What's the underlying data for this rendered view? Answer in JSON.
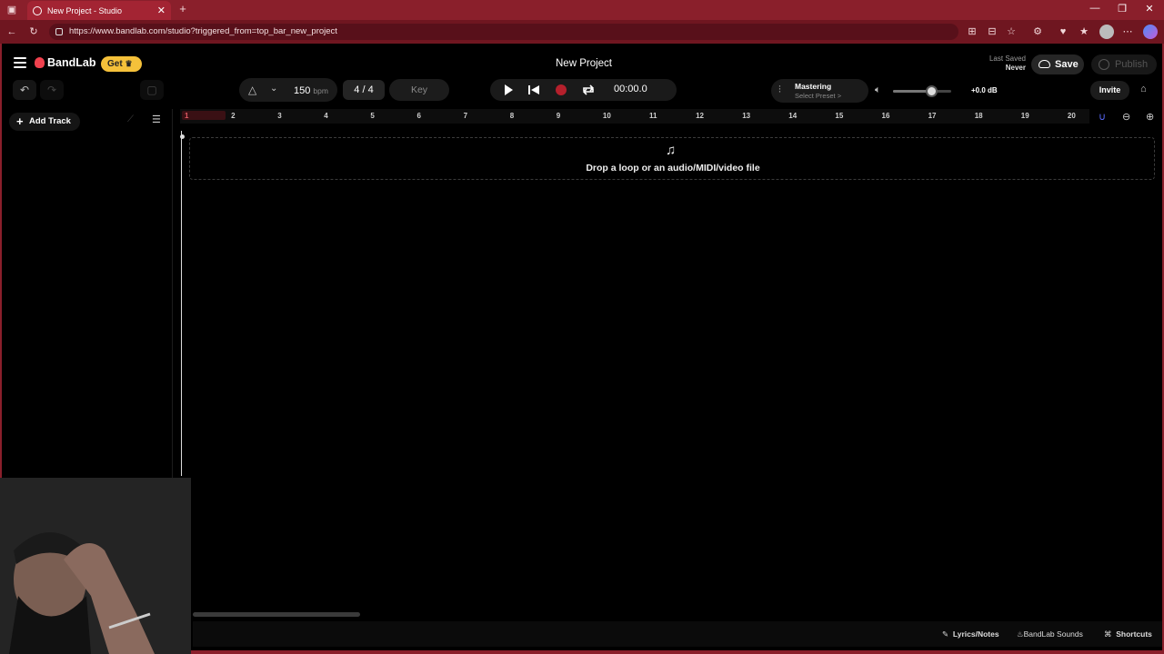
{
  "browser": {
    "tab_title": "New Project - Studio",
    "new_tab": "+",
    "url": "https://www.bandlab.com/studio?triggered_from=top_bar_new_project",
    "window_controls": [
      "—",
      "❐",
      "✕"
    ]
  },
  "header": {
    "brand": "BandLab",
    "get_label": "Get",
    "project_title": "New Project",
    "last_saved_label": "Last Saved",
    "last_saved_value": "Never",
    "save_label": "Save",
    "publish_label": "Publish"
  },
  "toolbar": {
    "bpm_value": "150",
    "bpm_unit": "bpm",
    "time_signature": "4 / 4",
    "key_label": "Key",
    "time_display": "00:00.0",
    "mastering_label": "Mastering",
    "mastering_preset": "Select Preset >",
    "volume_db": "+0.0 dB",
    "master_volume_level": 0.66,
    "invite_label": "Invite"
  },
  "tracks_panel": {
    "add_track_label": "Add Track"
  },
  "ruler": {
    "bars": [
      "1",
      "2",
      "3",
      "4",
      "5",
      "6",
      "7",
      "8",
      "9",
      "10",
      "11",
      "12",
      "13",
      "14",
      "15",
      "16",
      "17",
      "18",
      "19",
      "20"
    ]
  },
  "arrange": {
    "drop_text": "Drop a loop or an audio/MIDI/video file"
  },
  "footer": {
    "lyrics_label": "Lyrics/Notes",
    "sounds_label": "BandLab Sounds",
    "shortcuts_label": "Shortcuts"
  },
  "colors": {
    "browser_chrome": "#8a1f2b",
    "accent_red": "#b5202c",
    "get_badge": "#f5c13a",
    "background": "#000000"
  }
}
